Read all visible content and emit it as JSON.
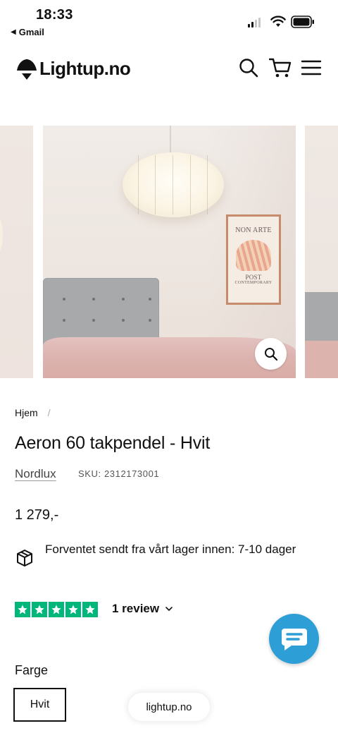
{
  "status_bar": {
    "time": "18:33",
    "back_app": "Gmail"
  },
  "header": {
    "logo_text": "Lightup.no",
    "icons": [
      "search-icon",
      "cart-icon",
      "menu-icon"
    ]
  },
  "gallery": {
    "poster_line1": "NON ARTE",
    "poster_line2": "POST",
    "poster_line3": "CONTEMPORARY"
  },
  "breadcrumb": {
    "home": "Hjem",
    "separator": "/"
  },
  "product": {
    "title": "Aeron 60 takpendel - Hvit",
    "vendor": "Nordlux",
    "sku": "SKU: 2312173001",
    "price": "1 279,-",
    "shipping_text": "Forventet sendt fra vårt lager innen: 7-10 dager",
    "rating_stars": 5,
    "review_label": "1 review",
    "color_label": "Farge",
    "selected_variant": "Hvit"
  },
  "browser": {
    "url": "lightup.no"
  },
  "colors": {
    "trustpilot_green": "#00b67a",
    "chat_blue": "#2e9fd6",
    "text": "#111111"
  }
}
